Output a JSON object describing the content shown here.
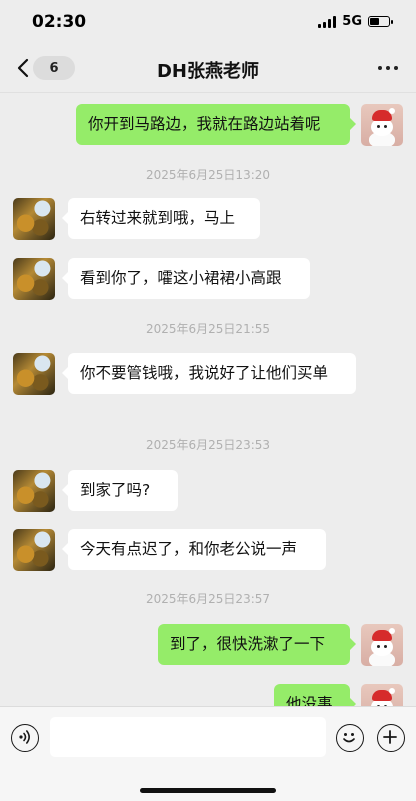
{
  "status": {
    "time": "02:30",
    "network": "5G"
  },
  "nav": {
    "back_count": "6",
    "title": "DH张燕老师"
  },
  "chat": {
    "items": [
      {
        "type": "msg",
        "side": "right",
        "text": "你开到马路边，我就在路边站着呢"
      },
      {
        "type": "time",
        "text": "2025年6月25日13:20"
      },
      {
        "type": "msg",
        "side": "left",
        "text": "右转过来就到哦，马上"
      },
      {
        "type": "msg",
        "side": "left",
        "text": "看到你了，嚯这小裙裙小高跟"
      },
      {
        "type": "time",
        "text": "2025年6月25日21:55"
      },
      {
        "type": "msg",
        "side": "left",
        "text": "你不要管钱哦，我说好了让他们买单"
      },
      {
        "type": "time",
        "text": "2025年6月25日23:53"
      },
      {
        "type": "msg",
        "side": "left",
        "text": "到家了吗?"
      },
      {
        "type": "msg",
        "side": "left",
        "text": "今天有点迟了，和你老公说一声"
      },
      {
        "type": "time",
        "text": "2025年6月25日23:57"
      },
      {
        "type": "msg",
        "side": "right",
        "text": "到了，很快洗漱了一下"
      },
      {
        "type": "msg",
        "side": "right",
        "text": "他没事"
      }
    ]
  },
  "input": {
    "placeholder": ""
  },
  "colors": {
    "bubble_self": "#95ec69",
    "bubble_other": "#ffffff",
    "background": "#ededed"
  }
}
